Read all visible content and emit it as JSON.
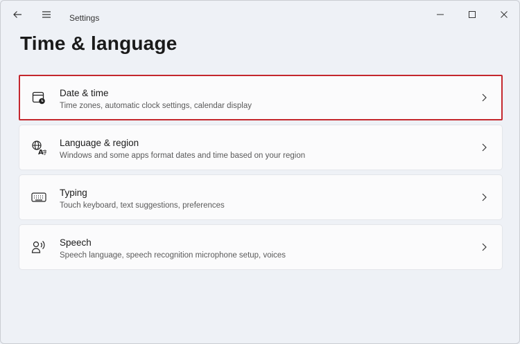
{
  "window": {
    "app_title": "Settings",
    "icons": {
      "back": "back-arrow-icon",
      "menu": "hamburger-menu-icon",
      "minimize": "minimize-icon",
      "maximize": "maximize-icon",
      "close": "close-icon"
    }
  },
  "page": {
    "title": "Time & language"
  },
  "accent": {
    "highlight_border": "#c4272d"
  },
  "items": [
    {
      "title": "Date & time",
      "subtitle": "Time zones, automatic clock settings, calendar display",
      "icon": "calendar-clock-icon",
      "highlighted": true
    },
    {
      "title": "Language & region",
      "subtitle": "Windows and some apps format dates and time based on your region",
      "icon": "language-globe-icon",
      "highlighted": false
    },
    {
      "title": "Typing",
      "subtitle": "Touch keyboard, text suggestions, preferences",
      "icon": "keyboard-icon",
      "highlighted": false
    },
    {
      "title": "Speech",
      "subtitle": "Speech language, speech recognition microphone setup, voices",
      "icon": "speech-icon",
      "highlighted": false
    }
  ]
}
